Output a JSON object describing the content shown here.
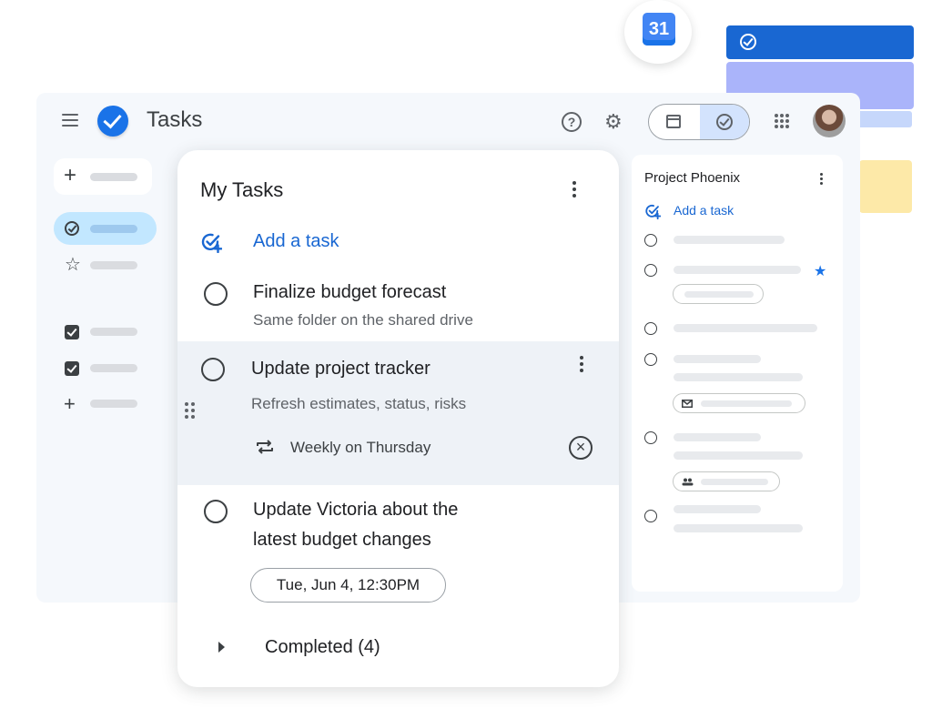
{
  "calendar_badge": {
    "day": "31"
  },
  "app": {
    "title": "Tasks"
  },
  "header": {
    "icons": [
      "menu-icon",
      "tasks-logo-icon",
      "help-icon",
      "settings-icon",
      "calendar-icon",
      "tasks-icon",
      "apps-icon",
      "avatar"
    ],
    "help_glyph": "?",
    "settings_glyph": "⚙"
  },
  "sidebar": {
    "create_glyph": "+",
    "star_glyph": "☆",
    "add_list_glyph": "+"
  },
  "main": {
    "title": "My Tasks",
    "add_task_label": "Add a task",
    "tasks": [
      {
        "title": "Finalize budget forecast",
        "details": "Same folder on the shared drive"
      },
      {
        "title": "Update project tracker",
        "details": "Refresh estimates, status, risks",
        "repeat": "Weekly on Thursday",
        "clear_glyph": "×"
      },
      {
        "title_line1": "Update Victoria about the",
        "title_line2": "latest budget changes",
        "date": "Tue, Jun 4, 12:30PM"
      }
    ],
    "completed_label": "Completed (4)"
  },
  "side_panel": {
    "title": "Project Phoenix",
    "add_task_label": "Add a task",
    "star_glyph": "★"
  },
  "colors": {
    "accent": "#1a73e8",
    "link": "#1967d2",
    "selected_nav": "#c2e7ff",
    "selected_row": "#eef2f7"
  }
}
